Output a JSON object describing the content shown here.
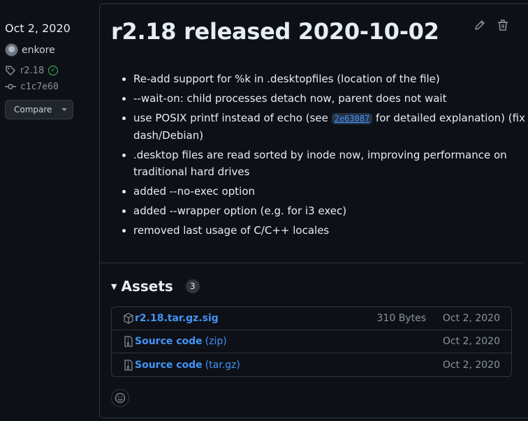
{
  "sidebar": {
    "date": "Oct 2, 2020",
    "author": "enkore",
    "tag": "r2.18",
    "commit": "c1c7e60",
    "compare_label": "Compare"
  },
  "release": {
    "title": "r2.18 released 2020-10-02",
    "notes": [
      {
        "text": "Re-add support for %k in .desktopfiles (location of the file)"
      },
      {
        "text": "--wait-on: child processes detach now, parent does not wait"
      },
      {
        "before": "use POSIX printf instead of echo (see ",
        "code": "2e63087",
        "after": " for detailed explanation) (fix for dash/Debian)"
      },
      {
        "text": ".desktop files are read sorted by inode now, improving performance on traditional hard drives"
      },
      {
        "text": "added --no-exec option"
      },
      {
        "text": "added --wrapper option (e.g. for i3 exec)"
      },
      {
        "text": "removed last usage of C/C++ locales"
      }
    ]
  },
  "assets": {
    "title": "Assets",
    "count": "3",
    "items": [
      {
        "name": "r2.18.tar.gz.sig",
        "sub": "",
        "size": "310 Bytes",
        "date": "Oct 2, 2020",
        "icon": "package-icon"
      },
      {
        "name": "Source code",
        "sub": "(zip)",
        "size": "",
        "date": "Oct 2, 2020",
        "icon": "file-zip-icon"
      },
      {
        "name": "Source code",
        "sub": "(tar.gz)",
        "size": "",
        "date": "Oct 2, 2020",
        "icon": "file-zip-icon"
      }
    ]
  },
  "colors": {
    "background": "#0d1117",
    "link": "#4493f8",
    "muted": "#8b949e",
    "border": "#30363d",
    "success": "#3fb950"
  }
}
